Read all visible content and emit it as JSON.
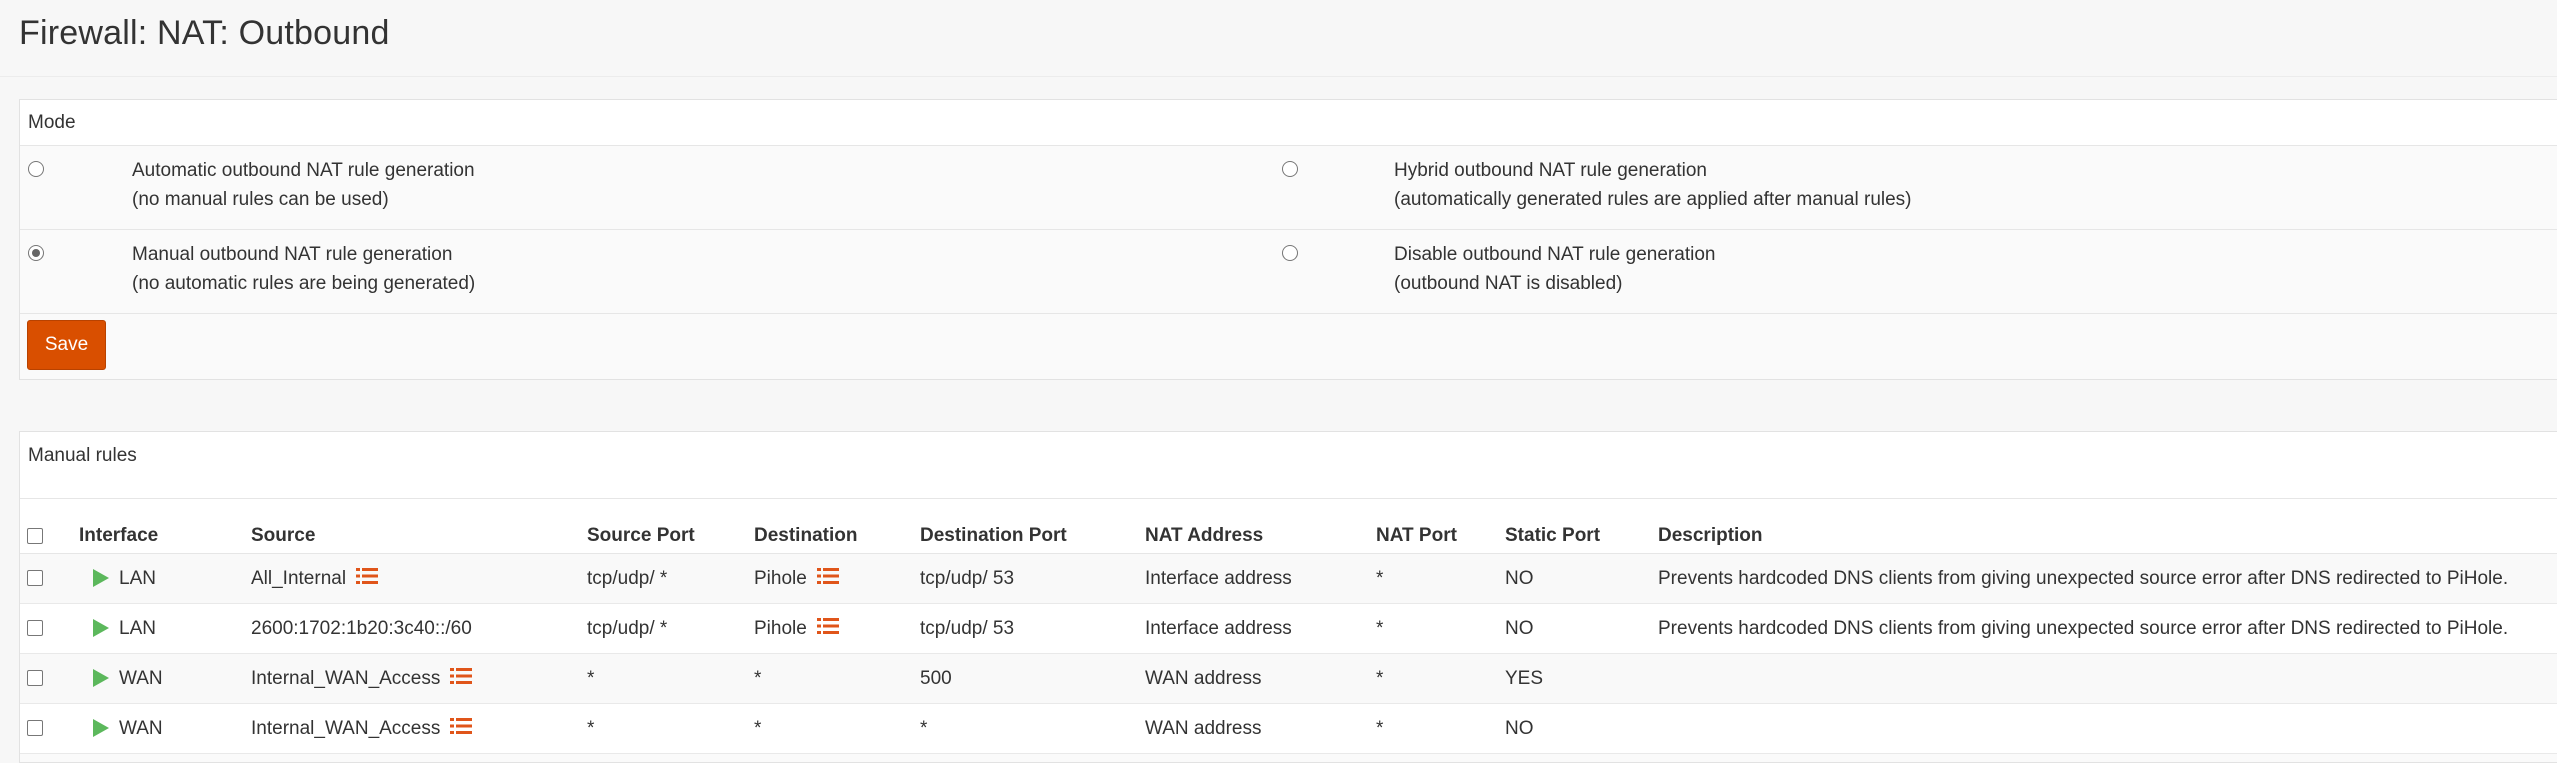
{
  "page": {
    "title": "Firewall: NAT: Outbound"
  },
  "mode": {
    "heading": "Mode",
    "options": [
      {
        "line1": "Automatic outbound NAT rule generation",
        "line2": "(no manual rules can be used)",
        "checked": false
      },
      {
        "line1": "Hybrid outbound NAT rule generation",
        "line2": "(automatically generated rules are applied after manual rules)",
        "checked": false
      },
      {
        "line1": "Manual outbound NAT rule generation",
        "line2": "(no automatic rules are being generated)",
        "checked": true
      },
      {
        "line1": "Disable outbound NAT rule generation",
        "line2": "(outbound NAT is disabled)",
        "checked": false
      }
    ],
    "save_label": "Save"
  },
  "rules": {
    "heading": "Manual rules",
    "columns": [
      "Interface",
      "Source",
      "Source Port",
      "Destination",
      "Destination Port",
      "NAT Address",
      "NAT Port",
      "Static Port",
      "Description"
    ],
    "rows": [
      {
        "interface": "LAN",
        "source": "All_Internal",
        "source_alias": true,
        "source_port": "tcp/udp/ *",
        "destination": "Pihole",
        "dest_alias": true,
        "destination_port": "tcp/udp/ 53",
        "nat_address": "Interface address",
        "nat_port": "*",
        "static_port": "NO",
        "description": "Prevents hardcoded DNS clients from giving unexpected source error after DNS redirected to PiHole."
      },
      {
        "interface": "LAN",
        "source": "2600:1702:1b20:3c40::/60",
        "source_alias": false,
        "source_port": "tcp/udp/ *",
        "destination": "Pihole",
        "dest_alias": true,
        "destination_port": "tcp/udp/ 53",
        "nat_address": "Interface address",
        "nat_port": "*",
        "static_port": "NO",
        "description": "Prevents hardcoded DNS clients from giving unexpected source error after DNS redirected to PiHole."
      },
      {
        "interface": "WAN",
        "source": "Internal_WAN_Access",
        "source_alias": true,
        "source_port": "*",
        "destination": "*",
        "dest_alias": false,
        "destination_port": "500",
        "nat_address": "WAN address",
        "nat_port": "*",
        "static_port": "YES",
        "description": ""
      },
      {
        "interface": "WAN",
        "source": "Internal_WAN_Access",
        "source_alias": true,
        "source_port": "*",
        "destination": "*",
        "dest_alias": false,
        "destination_port": "*",
        "nat_address": "WAN address",
        "nat_port": "*",
        "static_port": "NO",
        "description": ""
      }
    ]
  },
  "colors": {
    "accent": "#d94f00",
    "enabled_icon": "#5cb85c",
    "alias_icon": "#e0551a"
  },
  "icons": {
    "enabled": "play-triangle-icon",
    "alias": "list-icon"
  }
}
